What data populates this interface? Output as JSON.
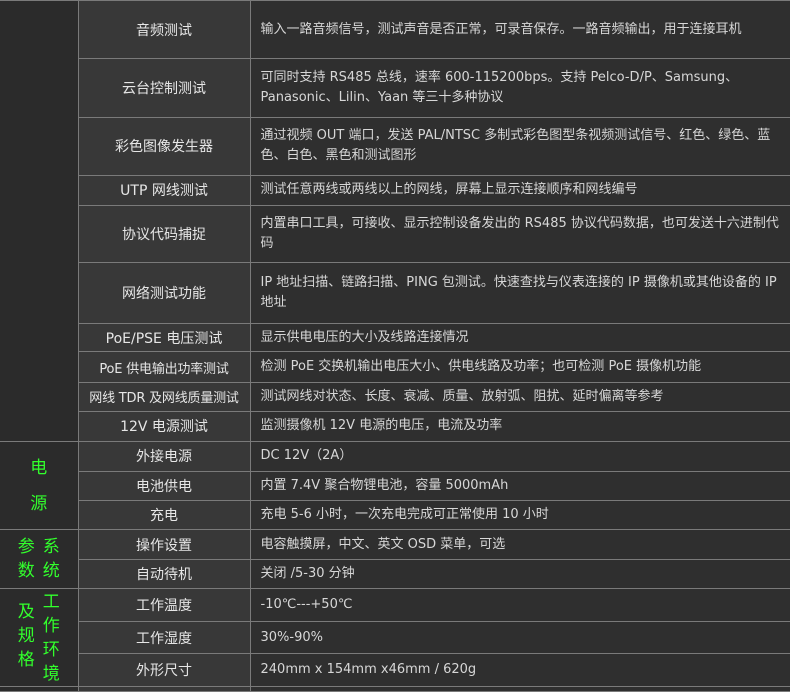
{
  "rows_top": [
    {
      "name": "音频测试",
      "desc": "输入一路音频信号，测试声音是否正常，可录音保存。一路音频输出，用于连接耳机"
    },
    {
      "name": "云台控制测试",
      "desc": "可同时支持 RS485 总线，速率 600-115200bps。支持 Pelco-D/P、Samsung、Panasonic、Lilin、Yaan 等三十多种协议"
    },
    {
      "name": "彩色图像发生器",
      "desc": "通过视频 OUT 端口，发送 PAL/NTSC 多制式彩色图型条视频测试信号、红色、绿色、蓝色、白色、黑色和测试图形"
    },
    {
      "name": "UTP 网线测试",
      "desc": "测试任意两线或两线以上的网线，屏幕上显示连接顺序和网线编号"
    },
    {
      "name": "协议代码捕捉",
      "desc": "内置串口工具，可接收、显示控制设备发出的 RS485 协议代码数据，也可发送十六进制代码"
    },
    {
      "name": "网络测试功能",
      "desc": "IP 地址扫描、链路扫描、PING 包测试。快速查找与仪表连接的 IP 摄像机或其他设备的 IP 地址"
    },
    {
      "name": "PoE/PSE 电压测试",
      "desc": "显示供电电压的大小及线路连接情况"
    },
    {
      "name": "PoE 供电输出功率测试",
      "desc": "检测 PoE 交换机输出电压大小、供电线路及功率；也可检测 PoE 摄像机功能"
    },
    {
      "name": "网线 TDR 及网线质量测试",
      "desc": "测试网线对状态、长度、衰减、质量、放射弧、阻扰、延时偏离等参考"
    },
    {
      "name": "12V 电源测试",
      "desc": "监测摄像机 12V 电源的电压，电流及功率"
    }
  ],
  "power": {
    "category": [
      "电",
      "源"
    ],
    "rows": [
      {
        "name": "外接电源",
        "desc": "DC 12V（2A）"
      },
      {
        "name": "电池供电",
        "desc": "内置 7.4V 聚合物锂电池，容量 5000mAh"
      },
      {
        "name": "充电",
        "desc": "充电 5-6 小时，一次充电完成可正常使用 10 小时"
      }
    ]
  },
  "system": {
    "category_left": [
      "参",
      "数"
    ],
    "category_right": [
      "系",
      "统"
    ],
    "rows": [
      {
        "name": "操作设置",
        "desc": "电容触摸屏，中文、英文 OSD 菜单，可选"
      },
      {
        "name": "自动待机",
        "desc": "关闭 /5-30 分钟"
      }
    ]
  },
  "env": {
    "category_left": [
      "及",
      "规",
      "格"
    ],
    "category_right": [
      "工",
      "作",
      "环",
      "境"
    ],
    "rows": [
      {
        "name": "工作温度",
        "desc": "-10℃---+50℃"
      },
      {
        "name": "工作湿度",
        "desc": "30%-90%"
      },
      {
        "name": "外形尺寸",
        "desc": "240mm x 154mm x46mm / 620g"
      }
    ]
  },
  "colors": {
    "background": "#2b2b2b",
    "name_cell": "#383838",
    "desc_cell": "#2f2f2f",
    "category_green": "#32ff2c",
    "grid_line": "#7a7a7a"
  }
}
